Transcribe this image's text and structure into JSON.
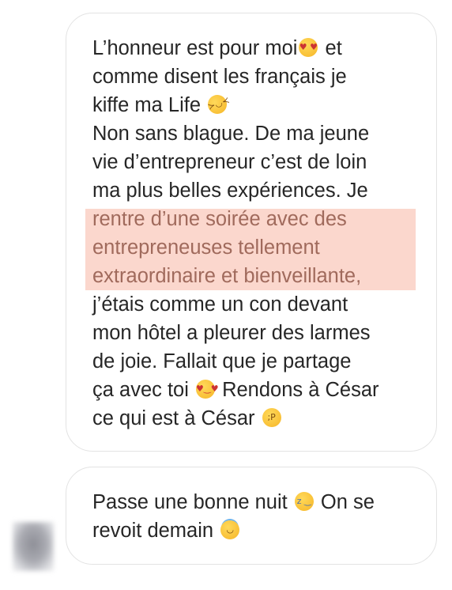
{
  "messages": [
    {
      "lines": [
        {
          "text": "L’honneur est pour moi",
          "emoji": "heart-eyes-emoji",
          "after": " et"
        },
        {
          "text": "comme disent les français je"
        },
        {
          "text": "kiffe ma Life",
          "emoji": "rofl-emoji"
        },
        {
          "text": "Non sans blague. De ma jeune"
        },
        {
          "text": "vie d’entrepreneur c’est de loin"
        },
        {
          "text": "ma plus belles expériences. Je"
        },
        {
          "text": "rentre d’une soirée avec des",
          "highlight": true
        },
        {
          "text": "entrepreneuses tellement",
          "highlight": true
        },
        {
          "text": "extraordinaire et bienveillante,",
          "highlight": true
        },
        {
          "text": "j’étais comme un con devant"
        },
        {
          "text": "mon hôtel a pleurer des larmes"
        },
        {
          "text": "de joie. Fallait que je partage"
        },
        {
          "text": "ça avec toi",
          "emoji": "smiling-hearts-emoji",
          "after": " Rendons à César"
        },
        {
          "text": "ce qui est à César",
          "emoji": "winking-tongue-emoji"
        }
      ]
    },
    {
      "lines": [
        {
          "text": "Passe une bonne nuit",
          "emoji": "sleeping-emoji",
          "after": " On se"
        },
        {
          "text": "revoit demain",
          "emoji": "halo-emoji"
        }
      ]
    }
  ],
  "colors": {
    "text": "#262626",
    "highlight_bg": "#fad0c4",
    "highlight_text": "#a06a5c",
    "bubble_border": "#e3e3e3"
  }
}
